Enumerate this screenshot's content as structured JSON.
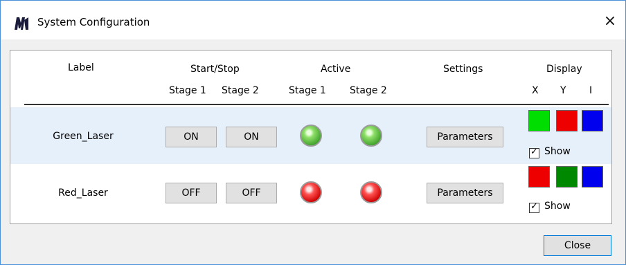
{
  "window": {
    "title": "System Configuration",
    "close_symbol": "×"
  },
  "headers": {
    "label": "Label",
    "start_stop": "Start/Stop",
    "active": "Active",
    "settings": "Settings",
    "display": "Display",
    "stage1_a": "Stage 1",
    "stage2_a": "Stage 2",
    "stage1_b": "Stage 1",
    "stage2_b": "Stage 2",
    "x": "X",
    "y": "Y",
    "i": "I"
  },
  "rows": [
    {
      "label": "Green_Laser",
      "stage1_button": "ON",
      "stage2_button": "ON",
      "stage1_active": "green",
      "stage2_active": "green",
      "settings_button": "Parameters",
      "display_colors": [
        "#00dd00",
        "#ee0000",
        "#0000ee"
      ],
      "show_label": "Show",
      "show_checked": true
    },
    {
      "label": "Red_Laser",
      "stage1_button": "OFF",
      "stage2_button": "OFF",
      "stage1_active": "red",
      "stage2_active": "red",
      "settings_button": "Parameters",
      "display_colors": [
        "#ee0000",
        "#008800",
        "#0000ee"
      ],
      "show_label": "Show",
      "show_checked": true
    }
  ],
  "footer": {
    "close_label": "Close"
  }
}
